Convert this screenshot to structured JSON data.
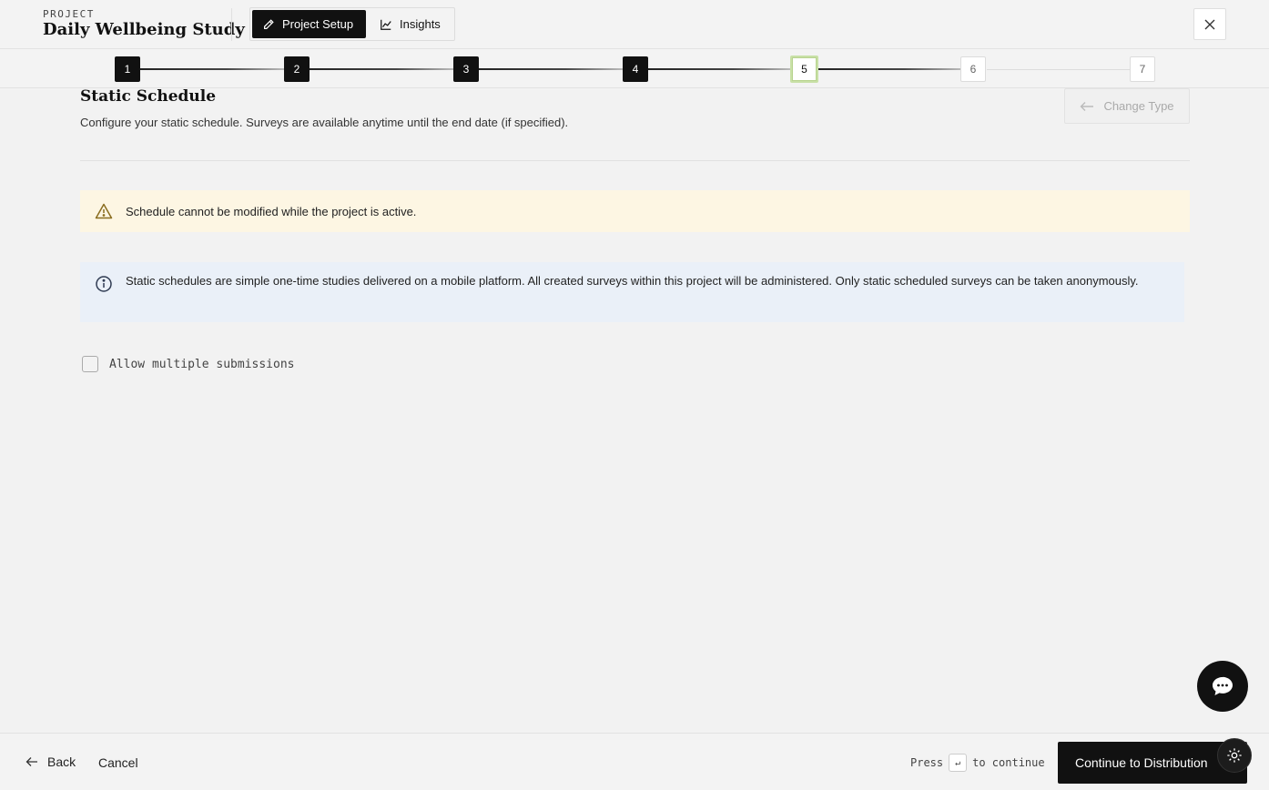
{
  "header": {
    "eyebrow": "PROJECT",
    "title": "Daily Wellbeing Study",
    "tabs": [
      {
        "label": "Project Setup",
        "icon": "pencil-icon",
        "active": true
      },
      {
        "label": "Insights",
        "icon": "line-chart-icon",
        "active": false
      }
    ],
    "close_icon": "close-icon"
  },
  "stepper": {
    "steps": [
      {
        "label": "1",
        "state": "done"
      },
      {
        "label": "2",
        "state": "done"
      },
      {
        "label": "3",
        "state": "done"
      },
      {
        "label": "4",
        "state": "done"
      },
      {
        "label": "5",
        "state": "current"
      },
      {
        "label": "6",
        "state": "todo"
      },
      {
        "label": "7",
        "state": "todo"
      }
    ]
  },
  "section": {
    "title": "Static Schedule",
    "description": "Configure your static schedule. Surveys are available anytime until the end date (if specified).",
    "change_type_label": "Change Type"
  },
  "warning": {
    "icon": "warning-icon",
    "text": "Schedule cannot be modified while the project is active.",
    "color": "#fdf6e3"
  },
  "info": {
    "icon": "info-icon",
    "text": "Static schedules are simple one-time studies delivered on a mobile platform. All created surveys within this project will be administered. Only static scheduled surveys can be taken anonymously.",
    "color": "#eaf0f8"
  },
  "options": {
    "allow_multiple_label": "Allow multiple submissions",
    "allow_multiple_checked": false
  },
  "footer": {
    "back_label": "Back",
    "cancel_label": "Cancel",
    "press_label": "Press",
    "enter_key": "↵",
    "to_continue_label": "to continue",
    "continue_label": "Continue to Distribution"
  }
}
